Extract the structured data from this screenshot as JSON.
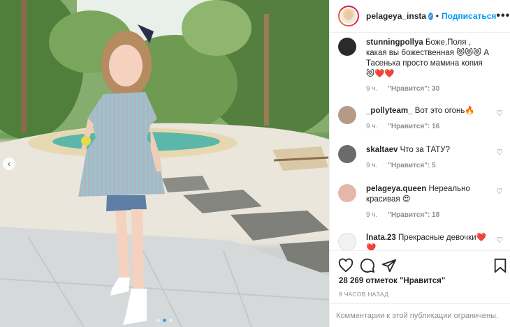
{
  "post": {
    "username": "pelageya_insta",
    "separator": "•",
    "follow_label": "Подписаться",
    "more_label": "•••",
    "verified_mark": "✓"
  },
  "carousel": {
    "prev_arrow": "‹",
    "slide_count": 3,
    "active_slide": 2
  },
  "comments": [
    {
      "username": "stunningpollya",
      "text": "Боже,Поля , какая вы божественная 😻😻😻 А Тасенька просто мамина копия 😻❤️❤️",
      "time": "9 ч.",
      "like_label": "\"Нравится\": 30",
      "avatar_color": "#2a2a2a"
    },
    {
      "username": "_pollyteam_",
      "text": "Вот это огонь🔥",
      "time": "9 ч.",
      "like_label": "\"Нравится\": 16",
      "avatar_color": "#b59a86"
    },
    {
      "username": "skaltaev",
      "text": "Что за ТАТУ?",
      "time": "9 ч.",
      "like_label": "\"Нравится\": 5",
      "avatar_color": "#6b6b6b"
    },
    {
      "username": "pelageya.queen",
      "text": "Нереально красивая 😍",
      "time": "9 ч.",
      "like_label": "\"Нравится\": 18",
      "avatar_color": "#e6b7a9"
    },
    {
      "username": "lnata.23",
      "text": "Прекрасные девочки❤️❤️",
      "time": "",
      "like_label": "",
      "avatar_color": "#f2f2f2"
    }
  ],
  "icons": {
    "like": "heart-icon",
    "comment": "comment-icon",
    "share": "share-icon",
    "save": "bookmark-icon",
    "comment_like": "heart-icon"
  },
  "comment_like_glyph": "♡",
  "footer": {
    "likes": "28 269 отметок \"Нравится\"",
    "timestamp": "9 ЧАСОВ НАЗАД",
    "comments_closed": "Комментарии к этой публикации ограничены."
  },
  "colors": {
    "accent": "#0095f6",
    "verified": "#3897f0",
    "muted": "#8e8e8e"
  }
}
